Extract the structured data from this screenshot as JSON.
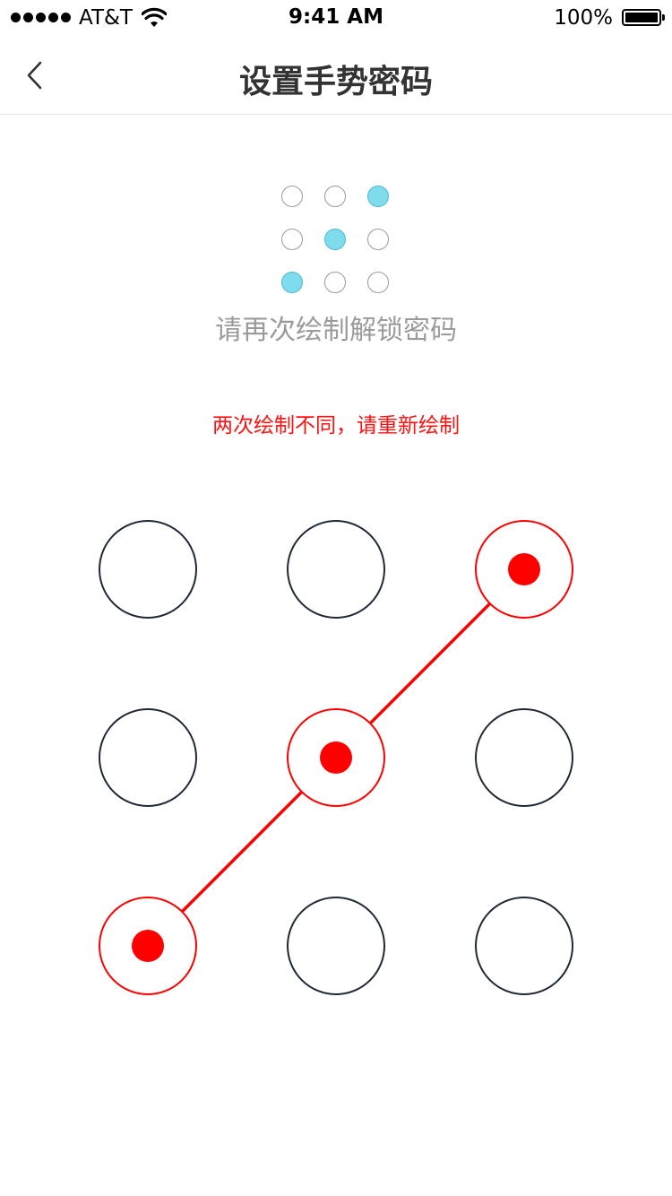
{
  "status_bar": {
    "carrier": "AT&T",
    "time": "9:41 AM",
    "battery": "100%",
    "signal_bars": 5
  },
  "nav": {
    "title": "设置手势密码",
    "back_icon": "chevron-left-icon"
  },
  "preview": {
    "active_points": [
      3,
      5,
      7
    ],
    "active_color": "#7fdcec"
  },
  "hint": "请再次绘制解锁密码",
  "error": "两次绘制不同，请重新绘制",
  "pattern": {
    "selected_points": [
      3,
      5,
      7
    ],
    "path": [
      7,
      5,
      3
    ],
    "state": "error",
    "error_color": "#ff0000",
    "idle_stroke": "#1f2937"
  }
}
